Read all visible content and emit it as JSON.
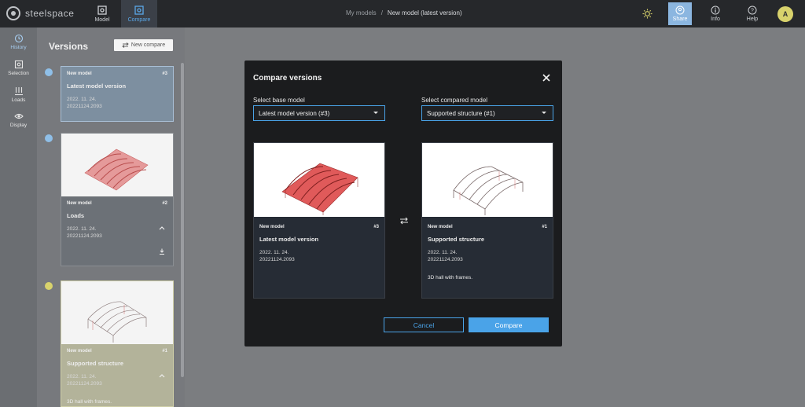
{
  "app": {
    "logo_text": "steelspace",
    "tabs": [
      {
        "label": "Model",
        "icon": "model-icon"
      },
      {
        "label": "Compare",
        "icon": "compare-icon"
      }
    ],
    "breadcrumb": {
      "root": "My models",
      "separator": "/",
      "current": "New model (latest version)"
    },
    "right_buttons": [
      {
        "label": "Share",
        "icon": "share-icon"
      },
      {
        "label": "Info",
        "icon": "info-icon"
      },
      {
        "label": "Help",
        "icon": "help-icon"
      }
    ],
    "avatar_initial": "A"
  },
  "leftnav": [
    {
      "label": "History",
      "icon": "history-icon"
    },
    {
      "label": "Selection",
      "icon": "selection-icon"
    },
    {
      "label": "Loads",
      "icon": "loads-icon"
    },
    {
      "label": "Display",
      "icon": "eye-icon"
    }
  ],
  "versions": {
    "title": "Versions",
    "new_compare_label": "New compare",
    "items": [
      {
        "model": "New model",
        "num": "#3",
        "name": "Latest model version",
        "date": "2022. 11. 24.",
        "build": "20221124.2093",
        "desc": ""
      },
      {
        "model": "New model",
        "num": "#2",
        "name": "Loads",
        "date": "2022. 11. 24.",
        "build": "20221124.2093",
        "desc": ""
      },
      {
        "model": "New model",
        "num": "#1",
        "name": "Supported structure",
        "date": "2022. 11. 24.",
        "build": "20221124.2093",
        "desc": "3D hall with frames."
      }
    ]
  },
  "modal": {
    "title": "Compare versions",
    "base_label": "Select base model",
    "base_value": "Latest model version (#3)",
    "compared_label": "Select compared model",
    "compared_value": "Supported structure (#1)",
    "base_card": {
      "model": "New model",
      "num": "#3",
      "name": "Latest model version",
      "date": "2022. 11. 24.",
      "build": "20221124.2093",
      "desc": ""
    },
    "compared_card": {
      "model": "New model",
      "num": "#1",
      "name": "Supported structure",
      "date": "2022. 11. 24.",
      "build": "20221124.2093",
      "desc": "3D hall with frames."
    },
    "cancel_label": "Cancel",
    "compare_label": "Compare"
  },
  "colors": {
    "accent": "#4aa3e8",
    "timeline_blue": "#8fbfe8",
    "timeline_yellow": "#d8d26c",
    "model_red": "#e05a5a"
  }
}
